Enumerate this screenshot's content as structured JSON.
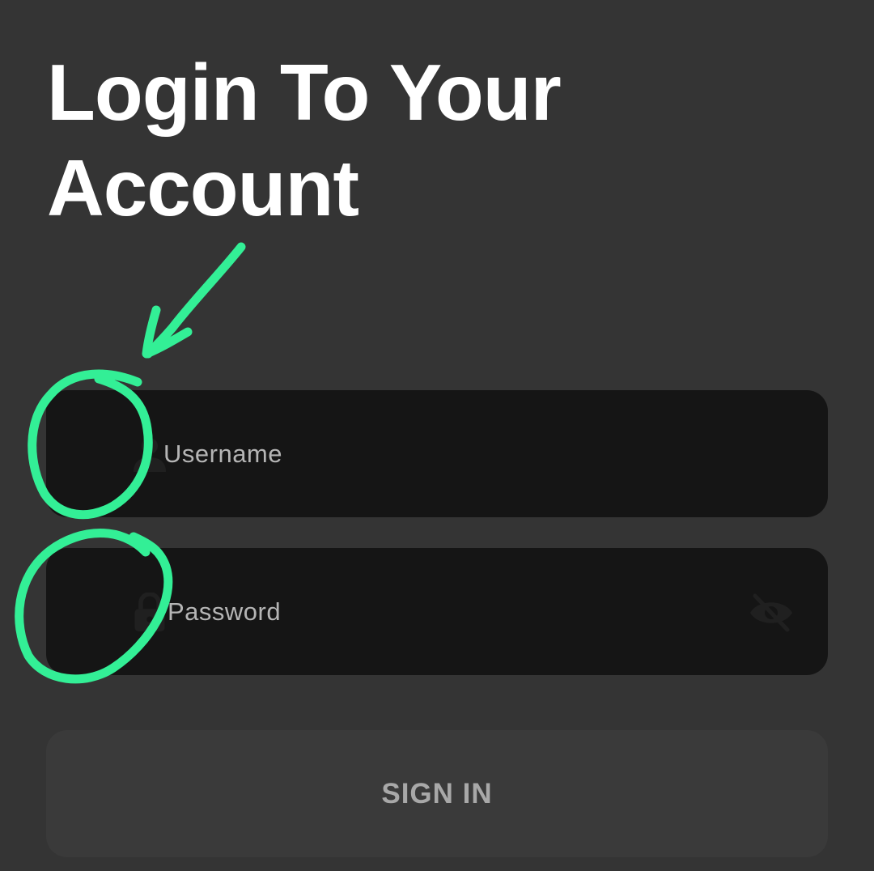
{
  "header": {
    "title_line1": "Login To Your",
    "title_line2": "Account"
  },
  "form": {
    "username": {
      "placeholder": "Username",
      "value": "",
      "icon": "person-icon"
    },
    "password": {
      "placeholder": "Password",
      "value": "",
      "icon": "lock-icon",
      "toggle_icon": "eye-off-icon"
    },
    "submit_label": "SIGN IN"
  },
  "colors": {
    "background": "#343434",
    "field_background": "#151515",
    "button_background": "#3a3a3a",
    "annotation": "#33ef96"
  }
}
